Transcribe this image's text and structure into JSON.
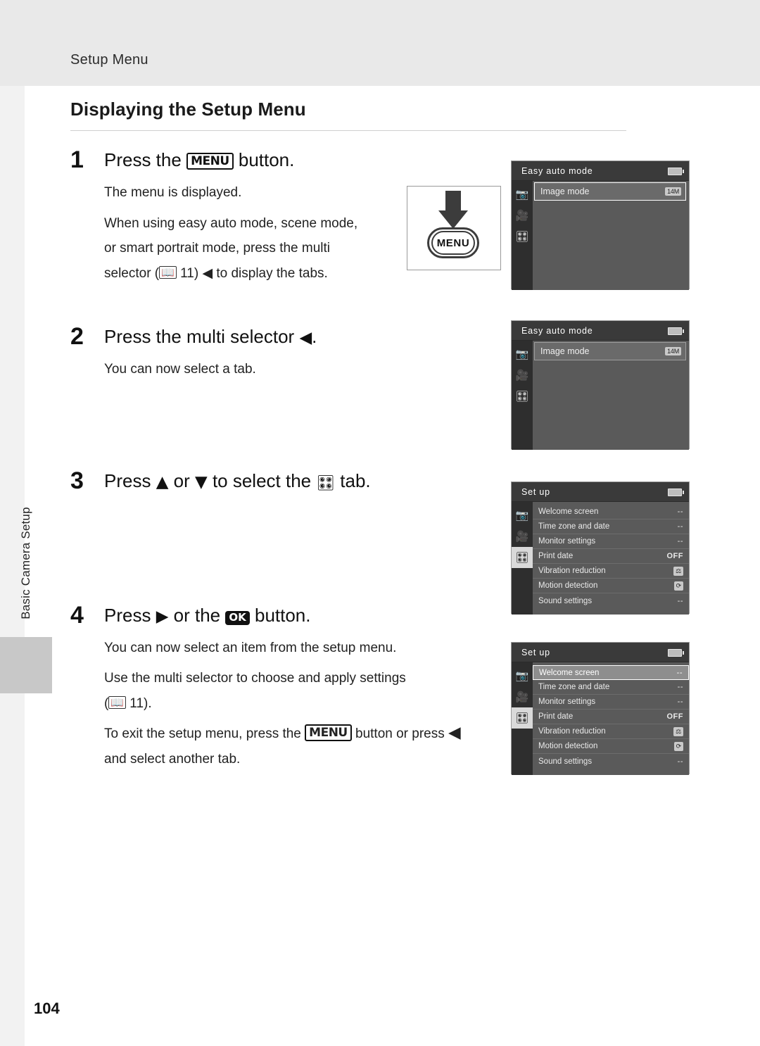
{
  "header": {
    "running_head": "Setup Menu",
    "side_tab_label": "Basic Camera Setup",
    "page_number": "104"
  },
  "section": {
    "title": "Displaying the Setup Menu"
  },
  "steps": [
    {
      "number": "1",
      "heading_before": "Press the",
      "heading_glyph": "MENU",
      "heading_after": "button.",
      "body": [
        "The menu is displayed.",
        "When using easy auto mode, scene mode, or smart portrait mode, press the multi selector (A 11) ◀ to display the tabs."
      ],
      "body_line1": "The menu is displayed.",
      "body_line2a": "When using easy auto mode, scene mode,",
      "body_line2b": "or smart portrait mode, press the multi",
      "body_line2c_pre": "selector (",
      "body_line2c_ref": "11",
      "body_line2c_post": "to display the tabs."
    },
    {
      "number": "2",
      "heading_before": "Press the multi selector",
      "heading_arrow": "◀",
      "heading_after": ".",
      "body_line1": "You can now select a tab."
    },
    {
      "number": "3",
      "heading_pre": "Press",
      "heading_up": "▲",
      "heading_or": "or",
      "heading_down": "▼",
      "heading_mid": "to select the",
      "heading_tab_icon": "wrench-icon",
      "heading_post": "tab."
    },
    {
      "number": "4",
      "heading_pre": "Press",
      "heading_right": "▶",
      "heading_mid": "or the",
      "heading_ok": "OK",
      "heading_post": "button.",
      "body_line1": "You can now select an item from the setup menu.",
      "body_line2a": "Use the multi selector to choose and apply settings",
      "body_line2b_pre": "(",
      "body_line2b_ref": "11",
      "body_line2b_post": ").",
      "body_line3a_pre": "To exit the setup menu, press the",
      "body_line3a_glyph": "MENU",
      "body_line3a_mid": "button or press",
      "body_line3a_arrow": "◀",
      "body_line3b": "and select another tab."
    }
  ],
  "menu_button_illustration": {
    "label": "MENU",
    "icon_arrow": "down-arrow-icon"
  },
  "screens": [
    {
      "id": "screen-1",
      "title": "Easy auto mode",
      "tabs": [
        "camera-icon",
        "movie-icon",
        "wrench-icon"
      ],
      "selected_tab_index": -1,
      "highlight_row": "Image mode",
      "rows": [
        {
          "label": "Image mode",
          "value": "14M",
          "highlighted": true
        }
      ]
    },
    {
      "id": "screen-2",
      "title": "Easy auto mode",
      "tabs": [
        "camera-icon",
        "movie-icon",
        "wrench-icon"
      ],
      "selected_tab_index": -1,
      "rows": [
        {
          "label": "Image mode",
          "value": "14M",
          "highlighted": false
        }
      ]
    },
    {
      "id": "screen-3",
      "title": "Set up",
      "tabs": [
        "camera-icon",
        "movie-icon",
        "wrench-icon"
      ],
      "selected_tab_index": 2,
      "rows": [
        {
          "label": "Welcome screen",
          "value": "--"
        },
        {
          "label": "Time zone and date",
          "value": "--"
        },
        {
          "label": "Monitor settings",
          "value": "--"
        },
        {
          "label": "Print date",
          "value": "OFF"
        },
        {
          "label": "Vibration reduction",
          "value": "vr-icon"
        },
        {
          "label": "Motion detection",
          "value": "motion-icon"
        },
        {
          "label": "Sound settings",
          "value": "--"
        }
      ]
    },
    {
      "id": "screen-4",
      "title": "Set up",
      "tabs": [
        "camera-icon",
        "movie-icon",
        "wrench-icon"
      ],
      "selected_tab_index": 2,
      "highlight_row": "Welcome screen",
      "rows": [
        {
          "label": "Welcome screen",
          "value": "--",
          "highlighted": true
        },
        {
          "label": "Time zone and date",
          "value": "--"
        },
        {
          "label": "Monitor settings",
          "value": "--"
        },
        {
          "label": "Print date",
          "value": "OFF"
        },
        {
          "label": "Vibration reduction",
          "value": "vr-icon"
        },
        {
          "label": "Motion detection",
          "value": "motion-icon"
        },
        {
          "label": "Sound settings",
          "value": "--"
        }
      ]
    }
  ],
  "colors": {
    "band": "#e9e9e9",
    "tab_marker": "#c8c8c8",
    "lcd_bg": "#5a5a5a",
    "lcd_title": "#3a3a3a",
    "highlight": "#8e8e8e"
  }
}
